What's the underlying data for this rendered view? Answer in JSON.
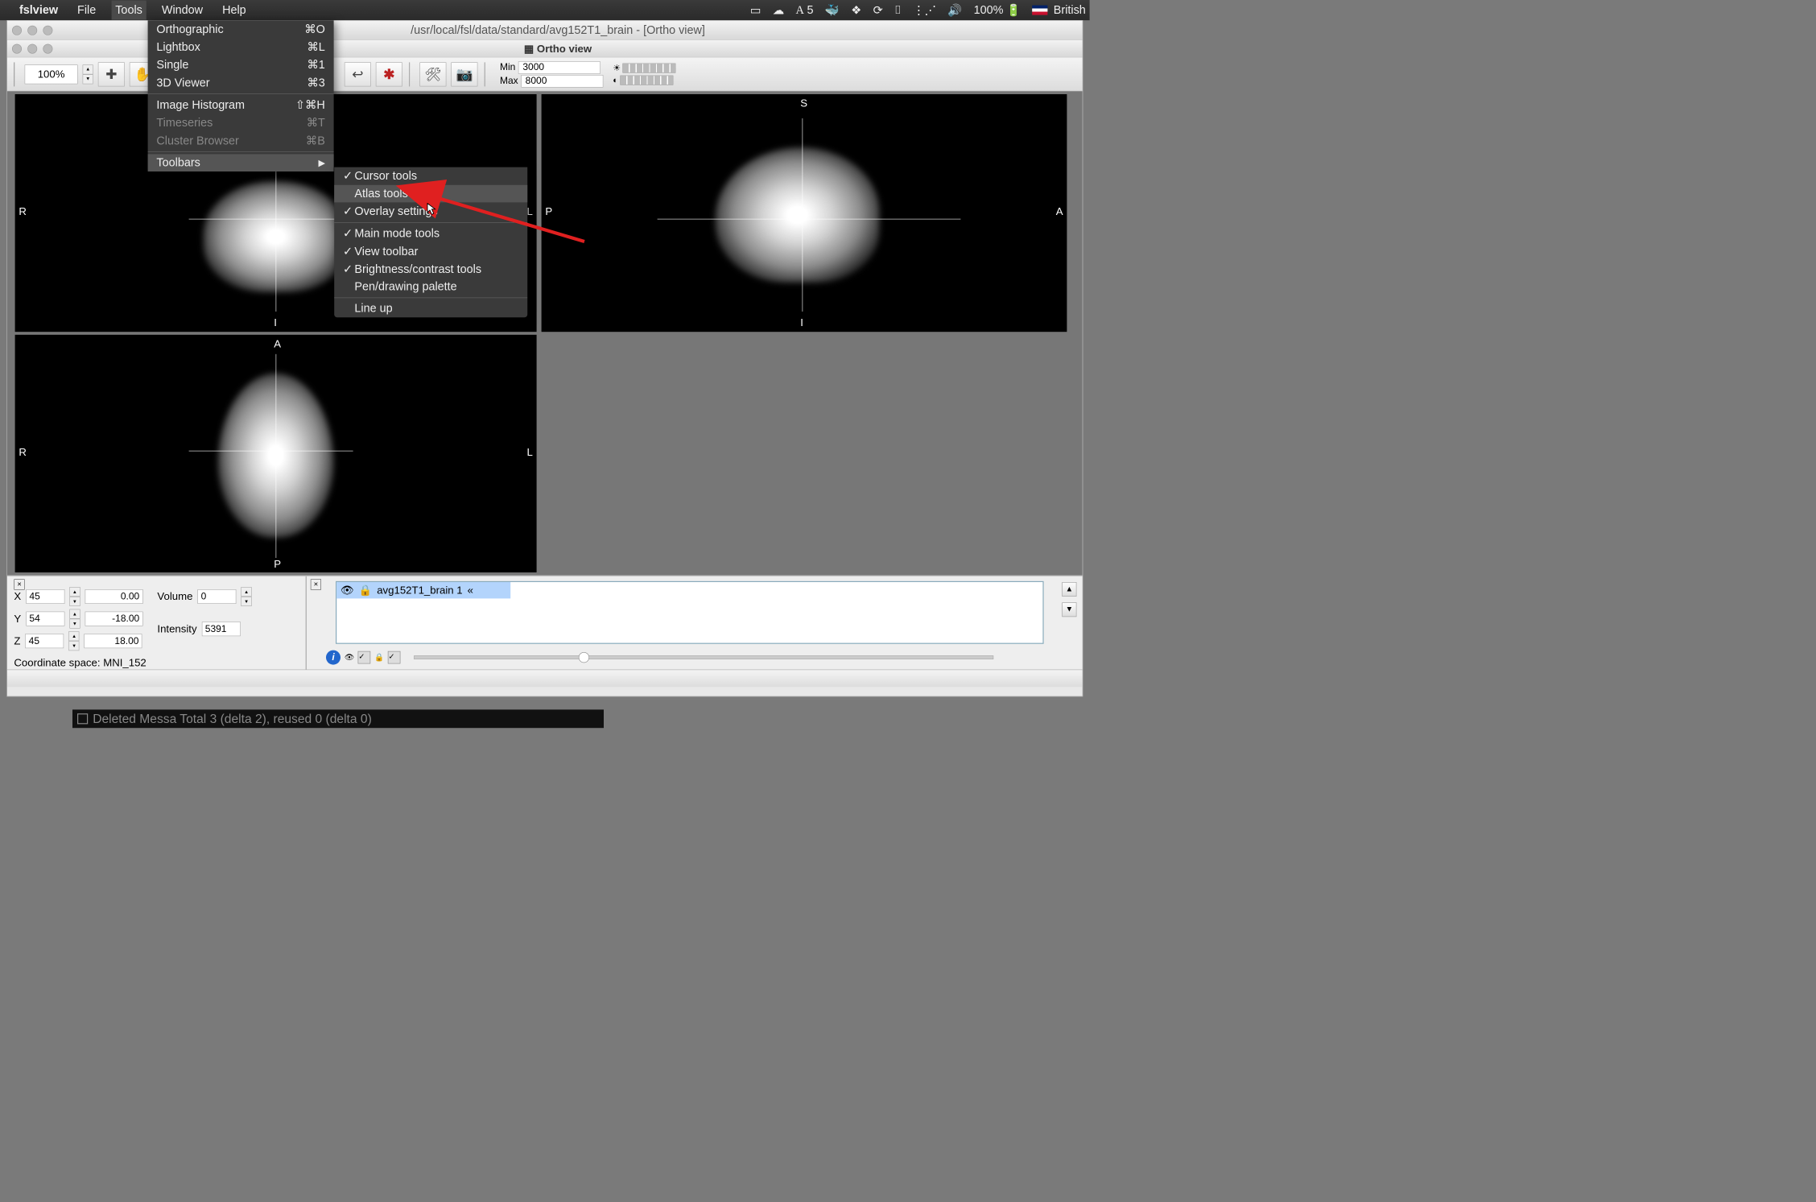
{
  "menubar": {
    "app": "fslview",
    "items": [
      "File",
      "Tools",
      "Window",
      "Help"
    ],
    "active": "Tools",
    "right": {
      "notif_count": "5",
      "battery": "100%",
      "language": "British"
    }
  },
  "tools_menu": {
    "items": [
      {
        "label": "Orthographic",
        "shortcut": "⌘O",
        "enabled": true
      },
      {
        "label": "Lightbox",
        "shortcut": "⌘L",
        "enabled": true
      },
      {
        "label": "Single",
        "shortcut": "⌘1",
        "enabled": true
      },
      {
        "label": "3D Viewer",
        "shortcut": "⌘3",
        "enabled": true
      },
      {
        "sep": true
      },
      {
        "label": "Image Histogram",
        "shortcut": "⇧⌘H",
        "enabled": true
      },
      {
        "label": "Timeseries",
        "shortcut": "⌘T",
        "enabled": false
      },
      {
        "label": "Cluster Browser",
        "shortcut": "⌘B",
        "enabled": false
      },
      {
        "sep": true
      },
      {
        "label": "Toolbars",
        "submenu": true,
        "highlight": true
      }
    ]
  },
  "toolbars_submenu": {
    "items": [
      {
        "label": "Cursor tools",
        "checked": true
      },
      {
        "label": "Atlas tools",
        "checked": false,
        "highlight": true
      },
      {
        "label": "Overlay settings",
        "checked": true
      },
      {
        "sep": true
      },
      {
        "label": "Main mode tools",
        "checked": true
      },
      {
        "label": "View toolbar",
        "checked": true
      },
      {
        "label": "Brightness/contrast tools",
        "checked": true
      },
      {
        "label": "Pen/drawing palette",
        "checked": false
      },
      {
        "sep": true
      },
      {
        "label": "Line up",
        "checked": false
      }
    ]
  },
  "window": {
    "title": "/usr/local/fsl/data/standard/avg152T1_brain - [Ortho view]",
    "subtitle": "Ortho view"
  },
  "toolbar": {
    "zoom": "100%",
    "min_label": "Min",
    "min_value": "3000",
    "max_label": "Max",
    "max_value": "8000"
  },
  "views": {
    "coronal": {
      "left": "R",
      "right": "L",
      "bottom": "I"
    },
    "sagittal": {
      "top": "S",
      "left": "P",
      "right": "A",
      "bottom": "I"
    },
    "axial": {
      "top": "A",
      "left": "R",
      "right": "L",
      "bottom": "P"
    }
  },
  "coords": {
    "x_label": "X",
    "x_vox": "45",
    "x_mm": "0.00",
    "y_label": "Y",
    "y_vox": "54",
    "y_mm": "-18.00",
    "z_label": "Z",
    "z_vox": "45",
    "z_mm": "18.00",
    "volume_label": "Volume",
    "volume_value": "0",
    "intensity_label": "Intensity",
    "intensity_value": "5391",
    "space_label": "Coordinate space: MNI_152"
  },
  "overlay": {
    "item": "avg152T1_brain 1"
  },
  "background_term": "Deleted Messa Total 3 (delta 2), reused 0 (delta 0)"
}
